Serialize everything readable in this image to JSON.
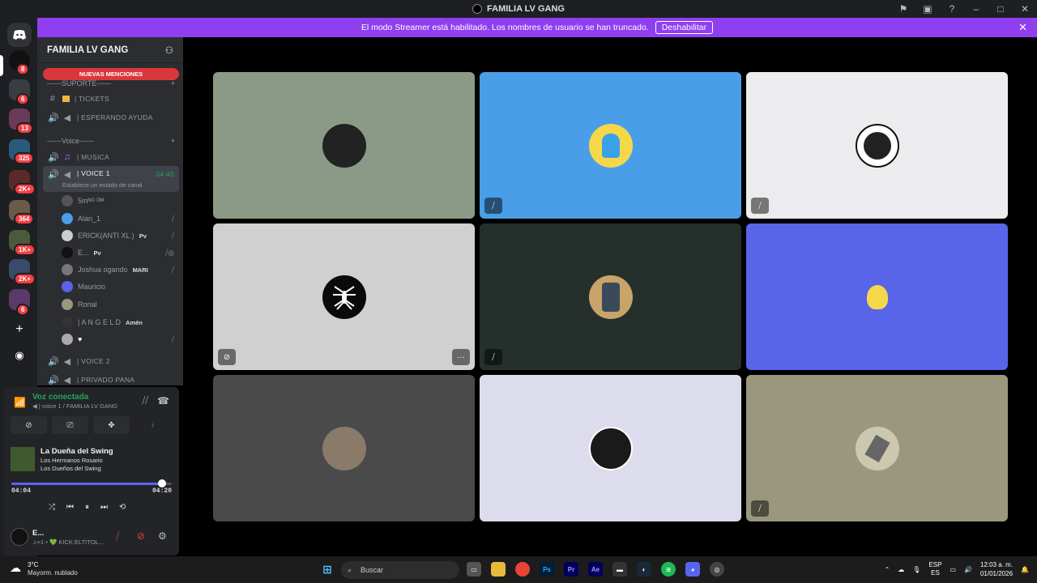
{
  "window": {
    "title": "FAMILIA LV GANG"
  },
  "banner": {
    "text": "El modo Streamer está habilitado. Los nombres de usuario se han truncado.",
    "button": "Deshabilitar"
  },
  "rail": {
    "badges": [
      "8",
      "6",
      "13",
      "325",
      "2K+",
      "364",
      "1K+",
      "2K+",
      "6"
    ]
  },
  "guild": {
    "name": "FAMILIA LV GANG",
    "new_mentions": "NUEVAS MENCIONES"
  },
  "categories": {
    "support": "------SUPORTE------",
    "voice": "------Voice------"
  },
  "channels": {
    "tickets": "| TICKETS",
    "esperando": "| ESPERANDO AYUDA",
    "musica": "| MUSICA",
    "voice1": "| VOICE 1",
    "voice1_time": "34:45",
    "voice1_status": "Establece un estado de canal",
    "voice2": "| VOICE 2",
    "privado": "| PRIVADO PANA"
  },
  "voice_users": [
    {
      "name": "5mᴺᴼ ᴰᴹ",
      "tag": ""
    },
    {
      "name": "Alan_1",
      "tag": ""
    },
    {
      "name": "ERICK(ANTI XL )",
      "tag": "Pv"
    },
    {
      "name": "E...",
      "tag": "Pv"
    },
    {
      "name": "Joshua ogando",
      "tag": "MARI"
    },
    {
      "name": "Mauricio",
      "tag": ""
    },
    {
      "name": "Ronal",
      "tag": ""
    },
    {
      "name": "| A N G E L D",
      "tag": "Amén"
    },
    {
      "name": "♥",
      "tag": ""
    }
  ],
  "voice_panel": {
    "status": "Voz conectada",
    "location": "| voice 1 / FAMILIA LV GANG"
  },
  "music": {
    "song": "La Dueña del Swing",
    "artist": "Los Hermanos Rosario",
    "album": "Los Dueños del Swing",
    "elapsed": "04:04",
    "total": "04:20",
    "progress": 0.94
  },
  "user": {
    "name": "E...",
    "status": "♫+1 • 💚 KICK:ELTITOL..."
  },
  "tiles_colors": [
    "#8a9a86",
    "#4a9ee8",
    "#ececef",
    "#d0d0d0",
    "#25302c",
    "#5865e8",
    "#4a4a4a",
    "#dcdcec",
    "#9a987c"
  ],
  "taskbar": {
    "temp": "3°C",
    "weather": "Mayorm. nublado",
    "search": "Buscar",
    "lang1": "ESP",
    "lang2": "ES",
    "time": "12:03 a. m.",
    "date": "01/01/2026"
  }
}
